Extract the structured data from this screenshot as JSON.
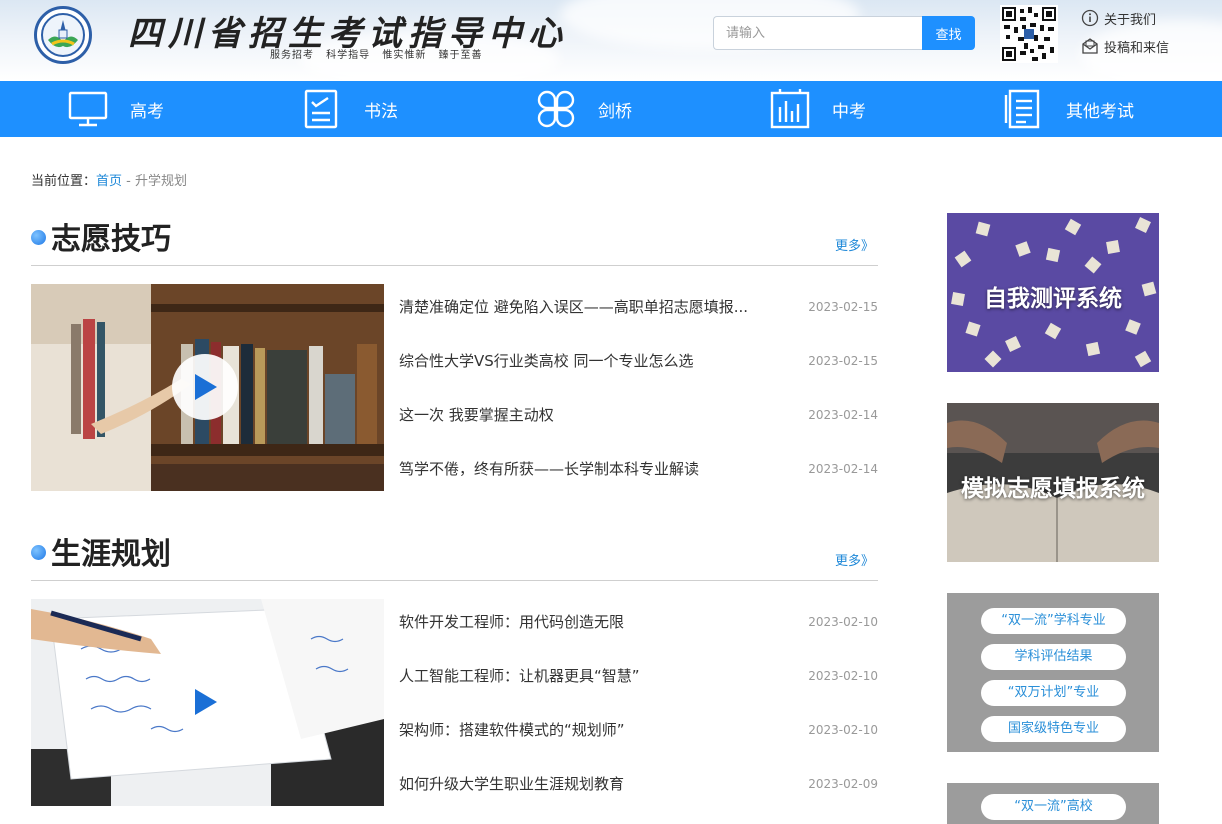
{
  "header": {
    "title": "四川省招生考试指导中心",
    "slogan": "服务招考 科学指导 惟实惟新 臻于至善",
    "search": {
      "placeholder": "请输入",
      "button": "查找"
    },
    "links": [
      {
        "label": "关于我们",
        "icon": "info-icon"
      },
      {
        "label": "投稿和来信",
        "icon": "mail-icon"
      }
    ]
  },
  "nav": [
    {
      "label": "高考",
      "icon": "monitor-icon"
    },
    {
      "label": "书法",
      "icon": "document-check-icon"
    },
    {
      "label": "剑桥",
      "icon": "grid-circles-icon"
    },
    {
      "label": "中考",
      "icon": "chart-bars-icon"
    },
    {
      "label": "其他考试",
      "icon": "document-list-icon"
    }
  ],
  "breadcrumb": {
    "prefix": "当前位置：",
    "home": "首页",
    "sep": " - ",
    "current": "升学规划"
  },
  "sections": [
    {
      "title": "志愿技巧",
      "more": "更多》",
      "items": [
        {
          "title": "清楚准确定位 避免陷入误区——高职单招志愿填报...",
          "date": "2023-02-15"
        },
        {
          "title": "综合性大学VS行业类高校 同一个专业怎么选",
          "date": "2023-02-15"
        },
        {
          "title": "这一次 我要掌握主动权",
          "date": "2023-02-14"
        },
        {
          "title": "笃学不倦，终有所获——长学制本科专业解读",
          "date": "2023-02-14"
        }
      ]
    },
    {
      "title": "生涯规划",
      "more": "更多》",
      "items": [
        {
          "title": "软件开发工程师：用代码创造无限",
          "date": "2023-02-10"
        },
        {
          "title": "人工智能工程师：让机器更具“智慧”",
          "date": "2023-02-10"
        },
        {
          "title": "架构师：搭建软件模式的“规划师”",
          "date": "2023-02-10"
        },
        {
          "title": "如何升级大学生职业生涯规划教育",
          "date": "2023-02-09"
        }
      ]
    }
  ],
  "sidebar": {
    "banners": [
      "自我测评系统",
      "模拟志愿填报系统"
    ],
    "pills": [
      "“双一流”学科专业",
      "学科评估结果",
      "“双万计划”专业",
      "国家级特色专业"
    ],
    "pills2": [
      "“双一流”高校"
    ]
  },
  "colors": {
    "primary": "#1e90ff",
    "link": "#1e88d8",
    "date": "#999999"
  }
}
